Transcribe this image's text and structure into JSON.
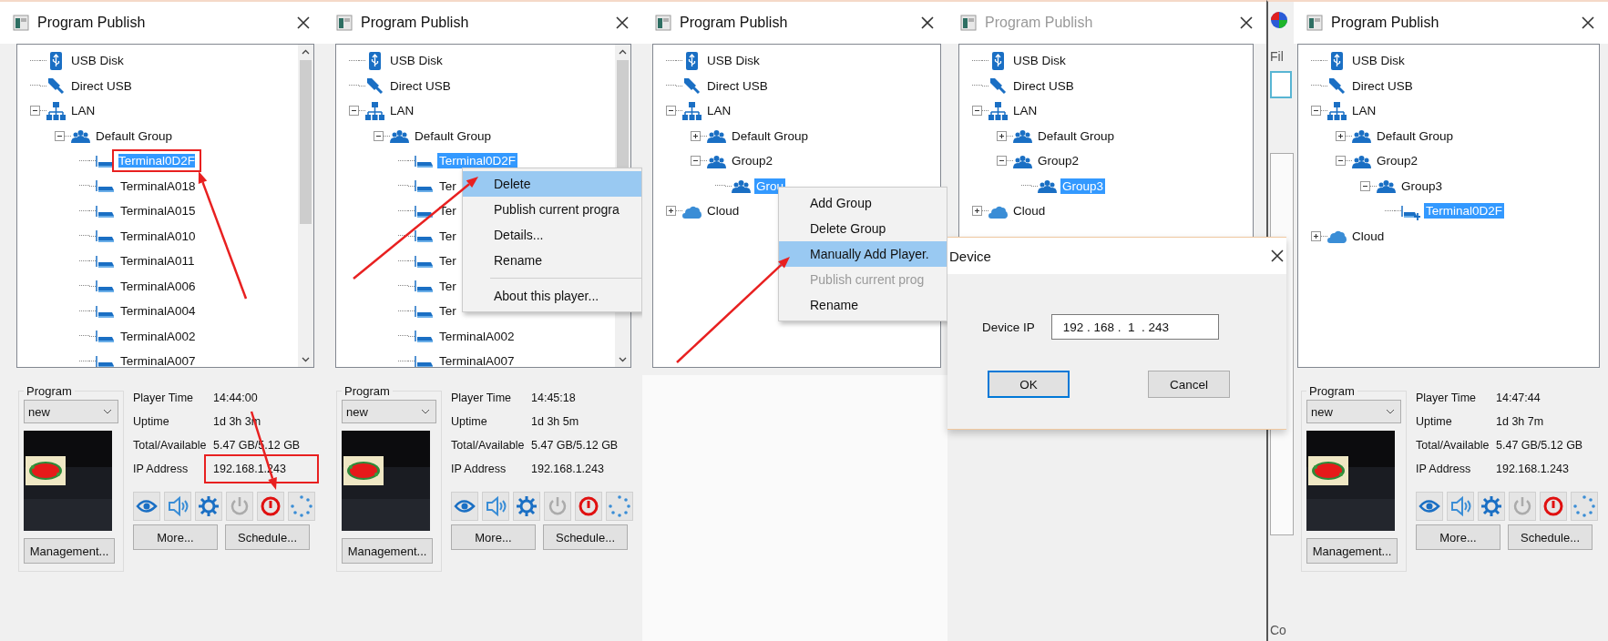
{
  "panels": [
    {
      "kind": "publish",
      "title": "Program Publish",
      "active": true,
      "tree": {
        "scrollable": true,
        "nodes": [
          {
            "label": "USB Disk",
            "kind": "usb-disk",
            "selected": false
          },
          {
            "label": "Direct USB",
            "kind": "direct-usb",
            "selected": false
          },
          {
            "label": "LAN",
            "kind": "lan",
            "expanded": true,
            "selected": false,
            "children": [
              {
                "label": "Default Group",
                "kind": "group",
                "expanded": true,
                "selected": false,
                "children": [
                  {
                    "label": "Terminal0D2F",
                    "kind": "terminal",
                    "selected": true,
                    "highlighted": true
                  },
                  {
                    "label": "TerminalA018",
                    "kind": "terminal",
                    "selected": false
                  },
                  {
                    "label": "TerminalA015",
                    "kind": "terminal",
                    "selected": false
                  },
                  {
                    "label": "TerminalA010",
                    "kind": "terminal",
                    "selected": false
                  },
                  {
                    "label": "TerminalA011",
                    "kind": "terminal",
                    "selected": false
                  },
                  {
                    "label": "TerminalA006",
                    "kind": "terminal",
                    "selected": false
                  },
                  {
                    "label": "TerminalA004",
                    "kind": "terminal",
                    "selected": false
                  },
                  {
                    "label": "TerminalA002",
                    "kind": "terminal",
                    "selected": false
                  },
                  {
                    "label": "TerminalA007",
                    "kind": "terminal",
                    "selected": false
                  }
                ]
              }
            ]
          }
        ]
      },
      "info": {
        "program_label": "Program",
        "program": "new",
        "management": "Management...",
        "rows": [
          {
            "label": "Player Time",
            "value": "14:44:00"
          },
          {
            "label": "Uptime",
            "value": "1d 3h 3m"
          },
          {
            "label": "Total/Available",
            "value": "5.47 GB/5.12 GB"
          },
          {
            "label": "IP Address",
            "value": "192.168.1.243",
            "highlighted": true
          }
        ],
        "tools": [
          {
            "kind": "eye",
            "disabled": false
          },
          {
            "kind": "speaker",
            "disabled": false
          },
          {
            "kind": "gear",
            "disabled": false
          },
          {
            "kind": "power",
            "disabled": true
          },
          {
            "kind": "alert",
            "disabled": false
          },
          {
            "kind": "dots",
            "disabled": false
          }
        ],
        "buttons": [
          "More...",
          "Schedule..."
        ]
      },
      "annotations": [
        {
          "kind": "arrow"
        },
        {
          "kind": "arrow"
        }
      ]
    },
    {
      "kind": "publish",
      "title": "Program Publish",
      "active": true,
      "tree": {
        "scrollable": true,
        "nodes": [
          {
            "label": "USB Disk",
            "kind": "usb-disk",
            "selected": false
          },
          {
            "label": "Direct USB",
            "kind": "direct-usb",
            "selected": false
          },
          {
            "label": "LAN",
            "kind": "lan",
            "expanded": true,
            "selected": false,
            "children": [
              {
                "label": "Default Group",
                "kind": "group",
                "expanded": true,
                "selected": false,
                "children": [
                  {
                    "label": "Terminal0D2F",
                    "kind": "terminal",
                    "selected": true
                  },
                  {
                    "label": "Ter",
                    "kind": "terminal",
                    "selected": false
                  },
                  {
                    "label": "Ter",
                    "kind": "terminal",
                    "selected": false
                  },
                  {
                    "label": "Ter",
                    "kind": "terminal",
                    "selected": false
                  },
                  {
                    "label": "Ter",
                    "kind": "terminal",
                    "selected": false
                  },
                  {
                    "label": "Ter",
                    "kind": "terminal",
                    "selected": false
                  },
                  {
                    "label": "Ter",
                    "kind": "terminal",
                    "selected": false
                  },
                  {
                    "label": "TerminalA002",
                    "kind": "terminal",
                    "selected": false
                  },
                  {
                    "label": "TerminalA007",
                    "kind": "terminal",
                    "selected": false
                  }
                ]
              }
            ]
          }
        ]
      },
      "context_menu": {
        "items": [
          {
            "kind": "item",
            "label": "Delete",
            "selected": true,
            "disabled": false
          },
          {
            "kind": "item",
            "label": "Publish current progra",
            "selected": false,
            "disabled": false
          },
          {
            "kind": "item",
            "label": "Details...",
            "selected": false,
            "disabled": false
          },
          {
            "kind": "item",
            "label": "Rename",
            "selected": false,
            "disabled": false
          },
          {
            "kind": "separator"
          },
          {
            "kind": "item",
            "label": "About this player...",
            "selected": false,
            "disabled": false
          }
        ]
      },
      "info": {
        "program_label": "Program",
        "program": "new",
        "management": "Management...",
        "rows": [
          {
            "label": "Player Time",
            "value": "14:45:18"
          },
          {
            "label": "Uptime",
            "value": "1d 3h 5m"
          },
          {
            "label": "Total/Available",
            "value": "5.47 GB/5.12 GB"
          },
          {
            "label": "IP Address",
            "value": "192.168.1.243"
          }
        ],
        "tools": [
          {
            "kind": "eye",
            "disabled": false
          },
          {
            "kind": "speaker",
            "disabled": false
          },
          {
            "kind": "gear",
            "disabled": false
          },
          {
            "kind": "power",
            "disabled": true
          },
          {
            "kind": "alert",
            "disabled": false
          },
          {
            "kind": "dots",
            "disabled": false
          }
        ],
        "buttons": [
          "More...",
          "Schedule..."
        ]
      },
      "annotations": [
        {
          "kind": "arrow"
        }
      ]
    },
    {
      "kind": "publish",
      "title": "Program Publish",
      "active": true,
      "tree": {
        "scrollable": false,
        "nodes": [
          {
            "label": "USB Disk",
            "kind": "usb-disk",
            "selected": false
          },
          {
            "label": "Direct USB",
            "kind": "direct-usb",
            "selected": false
          },
          {
            "label": "LAN",
            "kind": "lan",
            "expanded": true,
            "selected": false,
            "children": [
              {
                "label": "Default Group",
                "kind": "group",
                "expanded": false,
                "selected": false
              },
              {
                "label": "Group2",
                "kind": "group",
                "expanded": true,
                "selected": false,
                "children": [
                  {
                    "label": "Grou",
                    "kind": "group",
                    "selected": true
                  }
                ]
              }
            ]
          },
          {
            "label": "Cloud",
            "kind": "cloud",
            "expanded": false,
            "selected": false
          }
        ]
      },
      "context_menu": {
        "items": [
          {
            "kind": "item",
            "label": "Add Group",
            "selected": false,
            "disabled": false
          },
          {
            "kind": "item",
            "label": "Delete Group",
            "selected": false,
            "disabled": false
          },
          {
            "kind": "item",
            "label": "Manually Add Player.",
            "selected": true,
            "disabled": false
          },
          {
            "kind": "item",
            "label": "Publish current prog",
            "selected": false,
            "disabled": true
          },
          {
            "kind": "item",
            "label": "Rename",
            "selected": false,
            "disabled": false
          }
        ]
      },
      "annotations": [
        {
          "kind": "arrow"
        }
      ]
    },
    {
      "kind": "publish",
      "title": "Program Publish",
      "active": false,
      "tree": {
        "scrollable": false,
        "nodes": [
          {
            "label": "USB Disk",
            "kind": "usb-disk",
            "selected": false
          },
          {
            "label": "Direct USB",
            "kind": "direct-usb",
            "selected": false
          },
          {
            "label": "LAN",
            "kind": "lan",
            "expanded": true,
            "selected": false,
            "children": [
              {
                "label": "Default Group",
                "kind": "group",
                "expanded": false,
                "selected": false
              },
              {
                "label": "Group2",
                "kind": "group",
                "expanded": true,
                "selected": false,
                "children": [
                  {
                    "label": "Group3",
                    "kind": "group",
                    "selected": true
                  }
                ]
              }
            ]
          },
          {
            "label": "Cloud",
            "kind": "cloud",
            "expanded": false,
            "selected": false
          }
        ]
      },
      "dialog": {
        "title": "Device",
        "field_label": "Device IP",
        "field_value": "192 . 168 .  1  . 243",
        "buttons": [
          {
            "label": "OK",
            "default": true
          },
          {
            "label": "Cancel",
            "default": false
          }
        ]
      }
    },
    {
      "kind": "app-edge",
      "menu_text": "Fil",
      "footer_text": "Co"
    },
    {
      "kind": "publish",
      "title": "Program Publish",
      "active": true,
      "tree": {
        "scrollable": false,
        "nodes": [
          {
            "label": "USB Disk",
            "kind": "usb-disk",
            "selected": false
          },
          {
            "label": "Direct USB",
            "kind": "direct-usb",
            "selected": false
          },
          {
            "label": "LAN",
            "kind": "lan",
            "expanded": true,
            "selected": false,
            "children": [
              {
                "label": "Default Group",
                "kind": "group",
                "expanded": false,
                "selected": false
              },
              {
                "label": "Group2",
                "kind": "group",
                "expanded": true,
                "selected": false,
                "children": [
                  {
                    "label": "Group3",
                    "kind": "group",
                    "expanded": true,
                    "selected": false,
                    "children": [
                      {
                        "label": "Terminal0D2F",
                        "kind": "terminal-add",
                        "selected": true
                      }
                    ]
                  }
                ]
              }
            ]
          },
          {
            "label": "Cloud",
            "kind": "cloud",
            "expanded": false,
            "selected": false
          }
        ]
      },
      "info": {
        "program_label": "Program",
        "program": "new",
        "management": "Management...",
        "rows": [
          {
            "label": "Player Time",
            "value": "14:47:44"
          },
          {
            "label": "Uptime",
            "value": "1d 3h 7m"
          },
          {
            "label": "Total/Available",
            "value": "5.47 GB/5.12 GB"
          },
          {
            "label": "IP Address",
            "value": "192.168.1.243"
          }
        ],
        "tools": [
          {
            "kind": "eye",
            "disabled": false
          },
          {
            "kind": "speaker",
            "disabled": false
          },
          {
            "kind": "gear",
            "disabled": false
          },
          {
            "kind": "power",
            "disabled": true
          },
          {
            "kind": "alert",
            "disabled": false
          },
          {
            "kind": "dots",
            "disabled": false
          }
        ],
        "buttons": [
          "More...",
          "Schedule..."
        ]
      }
    }
  ]
}
